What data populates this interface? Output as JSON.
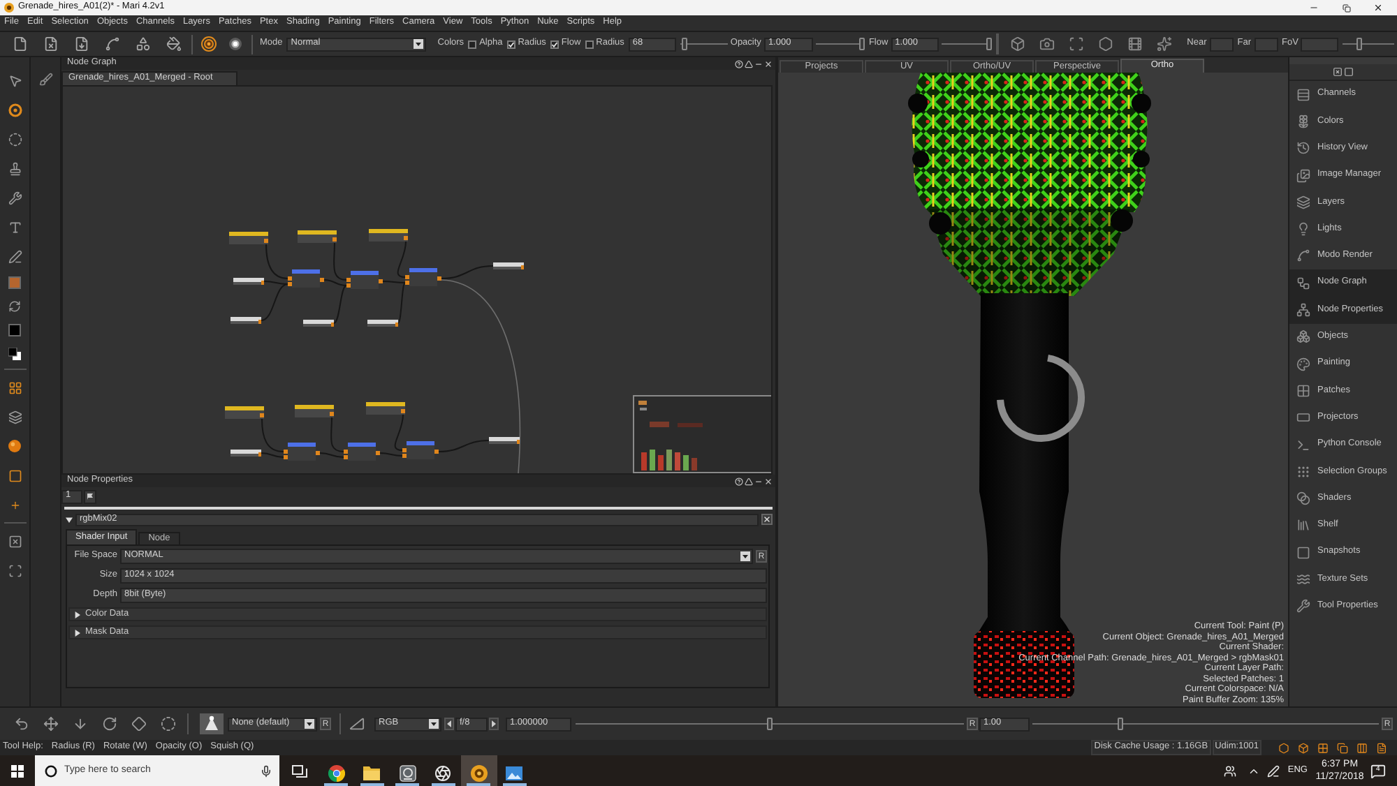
{
  "window": {
    "title": "Grenade_hires_A01(2)* - Mari 4.2v1"
  },
  "menu": [
    "File",
    "Edit",
    "Selection",
    "Objects",
    "Channels",
    "Layers",
    "Patches",
    "Ptex",
    "Shading",
    "Painting",
    "Filters",
    "Camera",
    "View",
    "Tools",
    "Python",
    "Nuke",
    "Scripts",
    "Help"
  ],
  "toolbar": {
    "mode": {
      "label": "Mode",
      "value": "Normal"
    },
    "colors_label": "Colors",
    "checks": [
      {
        "label": "Alpha",
        "checked": false
      },
      {
        "label": "Radius",
        "checked": true
      },
      {
        "label": "Flow",
        "checked": true
      },
      {
        "label": "Radius",
        "checked": false
      }
    ],
    "radius": {
      "value": "68",
      "level": 0.05
    },
    "opacity": {
      "label": "Opacity",
      "value": "1.000",
      "level": 1
    },
    "flow": {
      "label": "Flow",
      "value": "1.000",
      "level": 1
    },
    "near": {
      "label": "Near"
    },
    "far": {
      "label": "Far"
    },
    "fov": {
      "label": "FoV",
      "level": 0.3
    }
  },
  "tool_swatches": [
    {
      "color": "#b5652e"
    },
    {
      "color": "#000000"
    }
  ],
  "node_graph": {
    "title": "Node Graph",
    "tab": "Grenade_hires_A01_Merged - Root"
  },
  "node_properties": {
    "title": "Node Properties",
    "index": "1",
    "node": {
      "name": "rgbMix02",
      "expanded": true
    },
    "tabs": [
      {
        "label": "Shader Input",
        "selected": true
      },
      {
        "label": "Node",
        "selected": false
      }
    ],
    "fields": [
      {
        "label": "File Space",
        "value": "NORMAL",
        "kind": "dropdown",
        "reset": "R"
      },
      {
        "label": "Size",
        "value": "1024 x 1024",
        "kind": "text"
      },
      {
        "label": "Depth",
        "value": "8bit (Byte)",
        "kind": "text"
      }
    ],
    "sections": [
      {
        "label": "Color Data",
        "expanded": false
      },
      {
        "label": "Mask Data",
        "expanded": false
      }
    ]
  },
  "viewport": {
    "tabs": [
      {
        "label": "Projects",
        "selected": false
      },
      {
        "label": "UV",
        "selected": false
      },
      {
        "label": "Ortho/UV",
        "selected": false
      },
      {
        "label": "Perspective",
        "selected": false
      },
      {
        "label": "Ortho",
        "selected": true
      }
    ],
    "info": [
      "Current Tool: Paint (P)",
      "Current Object: Grenade_hires_A01_Merged",
      "Current Shader:",
      "Current Channel Path: Grenade_hires_A01_Merged > rgbMask01",
      "Current Layer Path:",
      "Selected Patches: 1",
      "Current Colorspace: N/A",
      "Paint Buffer Zoom: 135%"
    ]
  },
  "palettes": [
    {
      "label": "Channels",
      "selected": false
    },
    {
      "label": "Colors",
      "selected": false
    },
    {
      "label": "History View",
      "selected": false
    },
    {
      "label": "Image Manager",
      "selected": false
    },
    {
      "label": "Layers",
      "selected": false
    },
    {
      "label": "Lights",
      "selected": false
    },
    {
      "label": "Modo Render",
      "selected": false
    },
    {
      "label": "Node Graph",
      "selected": true
    },
    {
      "label": "Node Properties",
      "selected": true
    },
    {
      "label": "Objects",
      "selected": false
    },
    {
      "label": "Painting",
      "selected": false
    },
    {
      "label": "Patches",
      "selected": false
    },
    {
      "label": "Projectors",
      "selected": false
    },
    {
      "label": "Python Console",
      "selected": false
    },
    {
      "label": "Selection Groups",
      "selected": false
    },
    {
      "label": "Shaders",
      "selected": false
    },
    {
      "label": "Shelf",
      "selected": false
    },
    {
      "label": "Snapshots",
      "selected": false
    },
    {
      "label": "Texture Sets",
      "selected": false
    },
    {
      "label": "Tool Properties",
      "selected": false
    }
  ],
  "bottom_toolbar": {
    "brush_preset": "None (default)",
    "brush_reset": "R",
    "channel_view": "RGB",
    "fstop": "f/8",
    "exposure": {
      "value": "1.000000",
      "level": 0.5,
      "reset": "R"
    },
    "gamma": {
      "value": "1.00",
      "level": 0.25,
      "reset": "R"
    }
  },
  "status_bar": {
    "help": [
      "Tool Help:",
      "Radius (R)",
      "Rotate (W)",
      "Opacity (O)",
      "Squish (Q)"
    ],
    "disk_cache": "Disk Cache Usage : 1.16GB",
    "udim": "Udim:1001"
  },
  "taskbar": {
    "search": {
      "placeholder": "Type here to search"
    },
    "apps": [
      {
        "selected": false
      },
      {
        "selected": false
      },
      {
        "selected": false
      },
      {
        "selected": false
      },
      {
        "selected": true
      },
      {
        "selected": false
      }
    ],
    "language": "ENG",
    "time": "6:37 PM",
    "date": "11/27/2018",
    "notifications": "4"
  }
}
